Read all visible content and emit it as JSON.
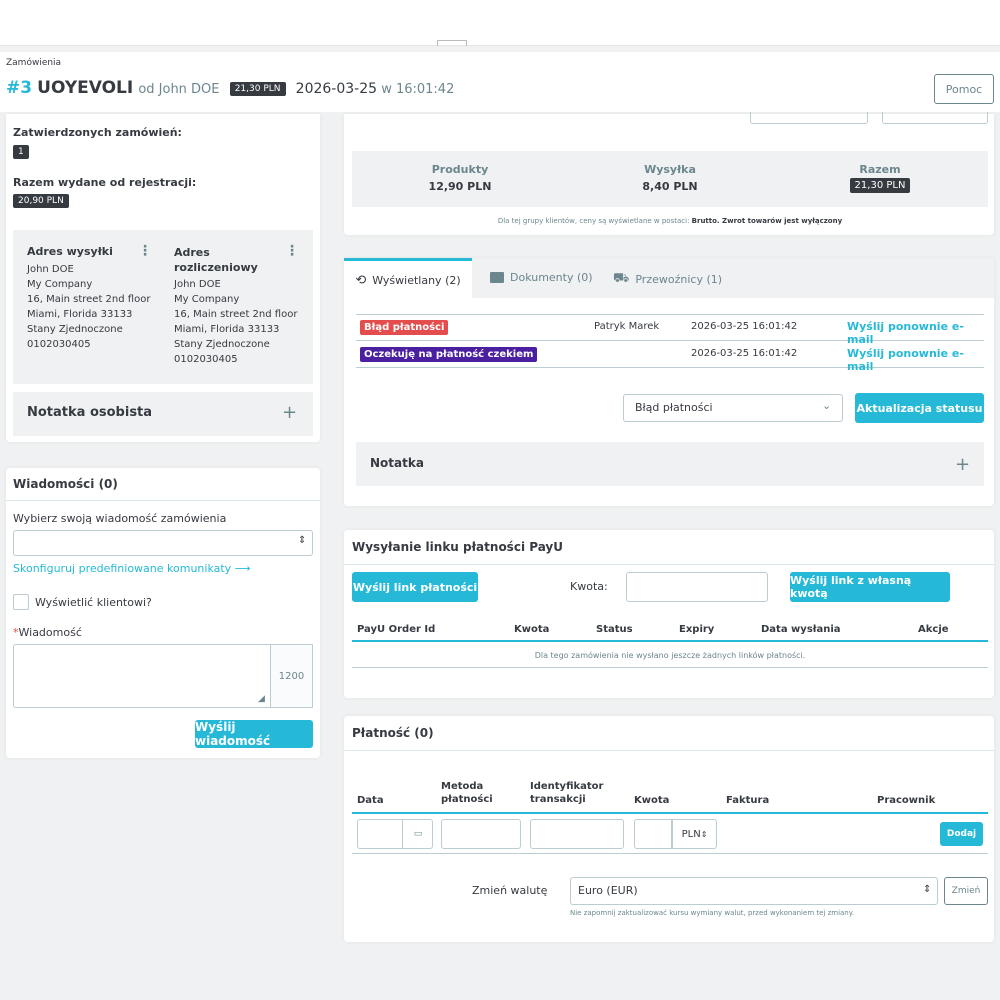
{
  "header": {
    "breadcrumb": "Zamówienia",
    "order_id": "#3",
    "order_ref": "UOYEVOLI",
    "by_text": "od John DOE",
    "total_pill": "21,30 PLN",
    "date_main": "2026-03-25",
    "date_rest": "w 16:01:42",
    "help_label": "Pomoc"
  },
  "customer": {
    "validated_orders_label": "Zatwierdzonych zamówień:",
    "validated_orders_value": "1",
    "spent_label": "Razem wydane od rejestracji:",
    "spent_value": "20,90 PLN",
    "shipping_address": {
      "title": "Adres wysyłki",
      "lines": [
        "John DOE",
        "My Company",
        "16, Main street 2nd floor",
        "Miami, Florida 33133",
        "Stany Zjednoczone",
        "0102030405"
      ]
    },
    "invoice_address": {
      "title": "Adres rozliczeniowy",
      "lines": [
        "John DOE",
        "My Company",
        "16, Main street 2nd floor",
        "Miami, Florida 33133",
        "Stany Zjednoczone",
        "0102030405"
      ]
    },
    "private_note_label": "Notatka osobista"
  },
  "messages": {
    "title": "Wiadomości (0)",
    "choose_label": "Wybierz swoją wiadomość zamówienia",
    "configure_link": "Skonfiguruj predefiniowane komunikaty",
    "display_to_customer": "Wyświetlić klientowi?",
    "message_label": "Wiadomość",
    "counter": "1200",
    "send_button": "Wyślij wiadomość"
  },
  "totals": {
    "products_label": "Produkty",
    "products_value": "12,90 PLN",
    "shipping_label": "Wysyłka",
    "shipping_value": "8,40 PLN",
    "total_label": "Razem",
    "total_value": "21,30 PLN",
    "note_prefix": "Dla tej grupy klientów, ceny są wyświetlane w postaci: ",
    "note_brutto": "Brutto.",
    "note_returns": " Zwrot towarów jest wyłączony"
  },
  "status_tabs": {
    "tab_history": "Wyświetlany (2)",
    "tab_documents": "Dokumenty (0)",
    "tab_carriers": "Przewoźnicy (1)"
  },
  "history": [
    {
      "status": "Błąd płatności",
      "color": "#e34d4d",
      "employee": "Patryk Marek",
      "date": "2026-03-25 16:01:42",
      "action": "Wyślij ponownie e-mail"
    },
    {
      "status": "Oczekuję na płatność czekiem",
      "color": "#4a1fa0",
      "employee": "",
      "date": "2026-03-25 16:01:42",
      "action": "Wyślij ponownie e-mail"
    }
  ],
  "status_update": {
    "selected": "Błąd płatności",
    "button": "Aktualizacja statusu",
    "note_label": "Notatka"
  },
  "payu": {
    "title": "Wysyłanie linku płatności PayU",
    "send_link": "Wyślij link płatności",
    "amount_label": "Kwota:",
    "send_custom": "Wyślij link z własną kwotą",
    "columns": [
      "PayU Order Id",
      "Kwota",
      "Status",
      "Expiry",
      "Data wysłania",
      "Akcje"
    ],
    "empty": "Dla tego zamówienia nie wysłano jeszcze żadnych linków płatności."
  },
  "payment": {
    "title": "Płatność (0)",
    "col_date": "Data",
    "col_method": "Metoda płatności",
    "col_txn": "Identyfikator transakcji",
    "col_amount": "Kwota",
    "col_invoice": "Faktura",
    "col_employee": "Pracownik",
    "currency_select": "PLN",
    "add_button": "Dodaj",
    "change_currency_label": "Zmień walutę",
    "currency_value": "Euro (EUR)",
    "change_button": "Zmień",
    "currency_note": "Nie zapomnij zaktualizować kursu wymiany walut, przed wykonaniem tej zmiany."
  }
}
